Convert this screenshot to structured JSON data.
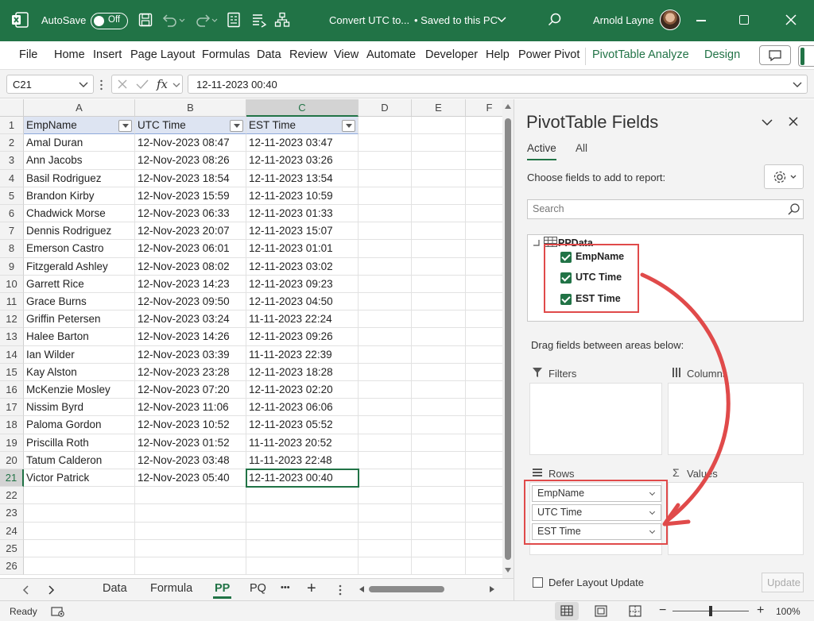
{
  "titlebar": {
    "autosave_label": "AutoSave",
    "autosave_state": "Off",
    "doc_title": "Convert UTC to...",
    "save_status": "• Saved to this PC",
    "user_name": "Arnold Layne"
  },
  "menu": {
    "items": [
      "File",
      "Home",
      "Insert",
      "Page Layout",
      "Formulas",
      "Data",
      "Review",
      "View",
      "Automate",
      "Developer",
      "Help",
      "Power Pivot",
      "PivotTable Analyze",
      "Design"
    ]
  },
  "formula": {
    "namebox": "C21",
    "fx_label": "fx",
    "value": "12-11-2023 00:40"
  },
  "grid": {
    "columns": [
      "A",
      "B",
      "C",
      "D",
      "E",
      "F"
    ],
    "headers": [
      "EmpName",
      "UTC Time",
      "EST Time"
    ],
    "row_numbers": [
      "1",
      "2",
      "3",
      "4",
      "5",
      "6",
      "7",
      "8",
      "9",
      "10",
      "11",
      "12",
      "13",
      "14",
      "15",
      "16",
      "17",
      "18",
      "19",
      "20",
      "21",
      "22",
      "23",
      "24",
      "25",
      "26"
    ],
    "rows": [
      [
        "Amal Duran",
        "12-Nov-2023 08:47",
        "12-11-2023 03:47"
      ],
      [
        "Ann Jacobs",
        "12-Nov-2023 08:26",
        "12-11-2023 03:26"
      ],
      [
        "Basil Rodriguez",
        "12-Nov-2023 18:54",
        "12-11-2023 13:54"
      ],
      [
        "Brandon Kirby",
        "12-Nov-2023 15:59",
        "12-11-2023 10:59"
      ],
      [
        "Chadwick Morse",
        "12-Nov-2023 06:33",
        "12-11-2023 01:33"
      ],
      [
        "Dennis Rodriguez",
        "12-Nov-2023 20:07",
        "12-11-2023 15:07"
      ],
      [
        "Emerson Castro",
        "12-Nov-2023 06:01",
        "12-11-2023 01:01"
      ],
      [
        "Fitzgerald Ashley",
        "12-Nov-2023 08:02",
        "12-11-2023 03:02"
      ],
      [
        "Garrett Rice",
        "12-Nov-2023 14:23",
        "12-11-2023 09:23"
      ],
      [
        "Grace Burns",
        "12-Nov-2023 09:50",
        "12-11-2023 04:50"
      ],
      [
        "Griffin Petersen",
        "12-Nov-2023 03:24",
        "11-11-2023 22:24"
      ],
      [
        "Halee Barton",
        "12-Nov-2023 14:26",
        "12-11-2023 09:26"
      ],
      [
        "Ian Wilder",
        "12-Nov-2023 03:39",
        "11-11-2023 22:39"
      ],
      [
        "Kay Alston",
        "12-Nov-2023 23:28",
        "12-11-2023 18:28"
      ],
      [
        "McKenzie Mosley",
        "12-Nov-2023 07:20",
        "12-11-2023 02:20"
      ],
      [
        "Nissim Byrd",
        "12-Nov-2023 11:06",
        "12-11-2023 06:06"
      ],
      [
        "Paloma Gordon",
        "12-Nov-2023 10:52",
        "12-11-2023 05:52"
      ],
      [
        "Priscilla Roth",
        "12-Nov-2023 01:52",
        "11-11-2023 20:52"
      ],
      [
        "Tatum Calderon",
        "12-Nov-2023 03:48",
        "11-11-2023 22:48"
      ],
      [
        "Victor Patrick",
        "12-Nov-2023 05:40",
        "12-11-2023 00:40"
      ]
    ]
  },
  "sheet_tabs": {
    "tabs": [
      "Data",
      "Formula",
      "PP",
      "PQ"
    ],
    "active": "PP",
    "more": "•••",
    "add": "+"
  },
  "status": {
    "ready": "Ready",
    "zoom": "100%"
  },
  "pivot": {
    "title": "PivotTable Fields",
    "tabs": [
      "Active",
      "All"
    ],
    "choose_label": "Choose fields to add to report:",
    "search_placeholder": "Search",
    "table_name": "PPData",
    "fields": [
      "EmpName",
      "UTC Time",
      "EST Time"
    ],
    "drag_label": "Drag fields between areas below:",
    "areas": {
      "filters": "Filters",
      "columns": "Columns",
      "rows": "Rows",
      "values": "Values"
    },
    "row_items": [
      "EmpName",
      "UTC Time",
      "EST Time"
    ],
    "defer_label": "Defer Layout Update",
    "update_label": "Update"
  },
  "colors": {
    "accent": "#217346",
    "annotation": "#e04a4a"
  }
}
